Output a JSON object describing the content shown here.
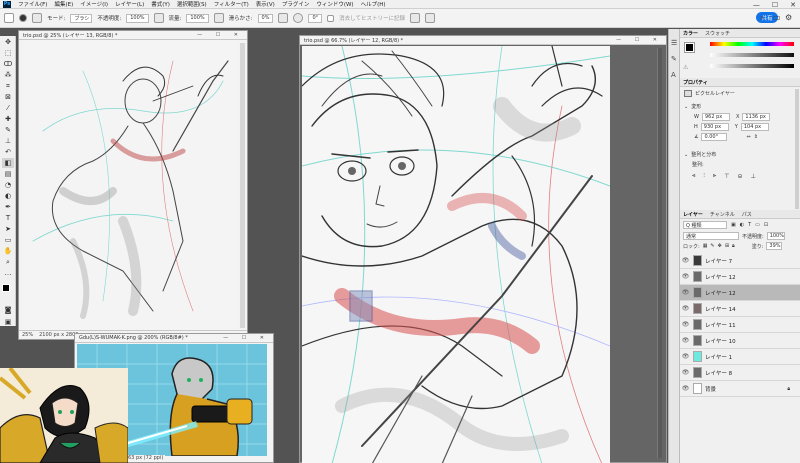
{
  "menubar": {
    "logo": "Ps",
    "items": [
      "ファイル(F)",
      "編集(E)",
      "イメージ(I)",
      "レイヤー(L)",
      "書式(Y)",
      "選択範囲(S)",
      "フィルター(T)",
      "表示(V)",
      "プラグイン",
      "ウィンドウ(W)",
      "ヘルプ(H)"
    ]
  },
  "window_controls": {
    "minimize": "—",
    "maximize": "☐",
    "close": "✕"
  },
  "options_bar": {
    "mode_label": "モード:",
    "mode_value": "ブラシ",
    "opacity_label": "不透明度:",
    "opacity_value": "100%",
    "flow_label": "流量:",
    "flow_value": "100%",
    "smoothing_label": "滑らかさ:",
    "smoothing_value": "0%",
    "angle_value": "0°",
    "erase_history_label": "消去してヒストリーに記録",
    "share_label": "共有"
  },
  "doc_left": {
    "title": "trio.psd @ 25% (レイヤー 13, RGB/8) *",
    "zoom": "25%",
    "doc_size": "2100 px x 2800 px"
  },
  "doc_main": {
    "title": "trio.psd @ 66.7% (レイヤー 12, RGB/8) *"
  },
  "doc_bottom": {
    "title": "Gdu(L)S-WUMAK-K.png @ 200% (RGB/8#) *",
    "status": "63 px (72 ppi)"
  },
  "color_panel": {
    "tabs": [
      "カラー",
      "スウォッチ"
    ],
    "accent": "#e84a3c"
  },
  "properties_panel": {
    "tab": "プロパティ",
    "layer_type": "ピクセルレイヤー",
    "section_transform": "変形",
    "w_label": "W",
    "w_value": "962 px",
    "h_label": "H",
    "h_value": "930 px",
    "x_label": "X",
    "x_value": "1136 px",
    "y_label": "Y",
    "y_value": "104 px",
    "angle_value": "0.00°",
    "section_align": "整列と分布",
    "align_label": "整列:"
  },
  "layers_panel": {
    "tabs": [
      "レイヤー",
      "チャンネル",
      "パス"
    ],
    "filter_label": "Q 種類",
    "blend_mode": "通常",
    "opacity_label": "不透明度:",
    "opacity_value": "100%",
    "lock_label": "ロック:",
    "fill_label": "塗り:",
    "fill_value": "39%",
    "layers": [
      {
        "name": "レイヤー 7",
        "thumb": "#3a3a3a",
        "selected": false
      },
      {
        "name": "レイヤー 12",
        "thumb": "#6a6a6a",
        "selected": false
      },
      {
        "name": "レイヤー 12",
        "thumb": "#6a6a6a",
        "selected": true
      },
      {
        "name": "レイヤー 14",
        "thumb": "#7a6a6a",
        "selected": false
      },
      {
        "name": "レイヤー 11",
        "thumb": "#6a6a6a",
        "selected": false
      },
      {
        "name": "レイヤー 10",
        "thumb": "#6a6a6a",
        "selected": false
      },
      {
        "name": "レイヤー 1",
        "thumb": "#6fe8e0",
        "selected": false
      },
      {
        "name": "レイヤー 8",
        "thumb": "#6a6a6a",
        "selected": false
      },
      {
        "name": "背景",
        "thumb": "#ffffff",
        "selected": false
      }
    ]
  },
  "tools": [
    "move-icon",
    "marquee-icon",
    "lasso-icon",
    "magic-wand-icon",
    "crop-icon",
    "frame-icon",
    "eyedropper-icon",
    "healing-icon",
    "brush-icon",
    "stamp-icon",
    "history-brush-icon",
    "eraser-icon",
    "gradient-icon",
    "blur-icon",
    "dodge-icon",
    "pen-icon",
    "type-icon",
    "path-select-icon",
    "shape-icon",
    "hand-icon",
    "zoom-icon",
    "more-icon"
  ]
}
